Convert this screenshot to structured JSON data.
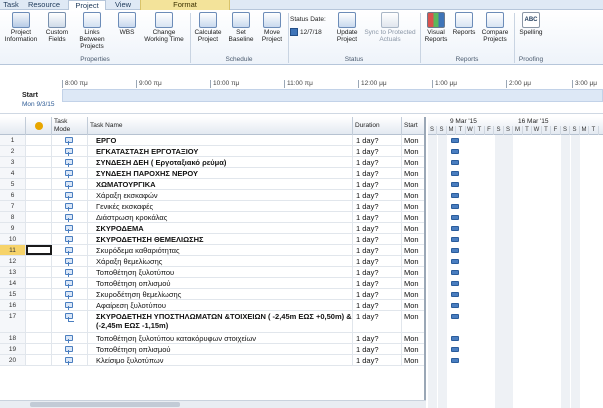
{
  "tabs": [
    "Task",
    "Resource",
    "Project",
    "View",
    "Format"
  ],
  "ribbon": {
    "buttons": {
      "project_information": "Project Information",
      "custom_fields": "Custom Fields",
      "links_between_projects": "Links Between Projects",
      "wbs": "WBS",
      "change_working_time": "Change Working Time",
      "calculate_project": "Calculate Project",
      "set_baseline": "Set Baseline",
      "move_project": "Move Project",
      "update_project": "Update Project",
      "sync_protected": "Sync to Protected Actuals",
      "visual_reports": "Visual Reports",
      "reports": "Reports",
      "compare_projects": "Compare Projects",
      "spelling": "Spelling"
    },
    "status_date_label": "Status Date:",
    "status_date_value": "12/7/18",
    "groups": {
      "properties": "Properties",
      "schedule": "Schedule",
      "status": "Status",
      "reports": "Reports",
      "proofing": "Proofing"
    },
    "spelling_badge": "ABC"
  },
  "timeline": {
    "start_label": "Start",
    "start_date": "Mon 9/3/15",
    "ticks": [
      "8:00 πμ",
      "9:00 πμ",
      "10:00 πμ",
      "11:00 πμ",
      "12:00 μμ",
      "1:00 μμ",
      "2:00 μμ",
      "3:00 μμ"
    ]
  },
  "grid": {
    "headers": {
      "mode": "Task Mode",
      "name": "Task Name",
      "duration": "Duration",
      "start": "Start"
    },
    "rows": [
      {
        "id": "1",
        "name": "ΕΡΓΟ",
        "duration": "1 day?",
        "start": "Mon",
        "bold": true
      },
      {
        "id": "2",
        "name": "ΕΓΚΑΤΑΣΤΑΣΗ ΕΡΓΟΤΑΞΙΟΥ",
        "duration": "1 day?",
        "start": "Mon",
        "bold": true
      },
      {
        "id": "3",
        "name": "ΣΥΝΔΕΣΗ ΔΕΗ ( Εργοταξιακό ρεύμα)",
        "duration": "1 day?",
        "start": "Mon",
        "bold": true
      },
      {
        "id": "4",
        "name": "ΣΥΝΔΕΣΗ ΠΑΡΟΧΗΣ ΝΕΡΟΥ",
        "duration": "1 day?",
        "start": "Mon",
        "bold": true
      },
      {
        "id": "5",
        "name": "ΧΩΜΑΤΟΥΡΓΙΚΑ",
        "duration": "1 day?",
        "start": "Mon",
        "bold": true
      },
      {
        "id": "6",
        "name": "Χάραξη εκσκαφών",
        "duration": "1 day?",
        "start": "Mon",
        "bold": false
      },
      {
        "id": "7",
        "name": "Γενικές εκσκαφές",
        "duration": "1 day?",
        "start": "Mon",
        "bold": false
      },
      {
        "id": "8",
        "name": "Διάστρωση κροκάλας",
        "duration": "1 day?",
        "start": "Mon",
        "bold": false
      },
      {
        "id": "9",
        "name": "ΣΚΥΡΟΔΕΜΑ",
        "duration": "1 day?",
        "start": "Mon",
        "bold": true
      },
      {
        "id": "10",
        "name": "ΣΚΥΡΟΔΕΤΗΣΗ ΘΕΜΕΛΙΩΣΗΣ",
        "duration": "1 day?",
        "start": "Mon",
        "bold": true
      },
      {
        "id": "11",
        "name": "Σκυρόδεμα καθαριότητας",
        "duration": "1 day?",
        "start": "Mon",
        "bold": false
      },
      {
        "id": "12",
        "name": "Χάραξη θεμελίωσης",
        "duration": "1 day?",
        "start": "Mon",
        "bold": false
      },
      {
        "id": "13",
        "name": "Τοποθέτηση ξυλοτύπου",
        "duration": "1 day?",
        "start": "Mon",
        "bold": false
      },
      {
        "id": "14",
        "name": "Τοποθέτηση οπλισμού",
        "duration": "1 day?",
        "start": "Mon",
        "bold": false
      },
      {
        "id": "15",
        "name": "Σκυροδέτηση θεμελίωσης",
        "duration": "1 day?",
        "start": "Mon",
        "bold": false
      },
      {
        "id": "16",
        "name": "Αφαίρεση ξυλοτύπου",
        "duration": "1 day?",
        "start": "Mon",
        "bold": false
      },
      {
        "id": "17",
        "name": "ΣΚΥΡΟΔΕΤΗΣΗ ΥΠΟΣΤΗΛΩΜΑΤΩΝ &ΤΟΙΧΕΙΩΝ ( -2,45m ΕΩΣ +0,50m) & (-2,45m ΕΩΣ -1,15m)",
        "duration": "1 day?",
        "start": "Mon",
        "bold": true
      },
      {
        "id": "18",
        "name": "Τοποθέτηση ξυλοτύπου κατακόρυφων στοιχείων",
        "duration": "1 day?",
        "start": "Mon",
        "bold": false
      },
      {
        "id": "19",
        "name": "Τοποθέτηση οπλισμού",
        "duration": "1 day?",
        "start": "Mon",
        "bold": false
      },
      {
        "id": "20",
        "name": "Κλείσιμο ξυλοτύπων",
        "duration": "1 day?",
        "start": "Mon",
        "bold": false
      }
    ]
  },
  "gantt": {
    "weeks": [
      "9 Mar '15",
      "16 Mar '15"
    ],
    "days": [
      "S",
      "S",
      "M",
      "T",
      "W",
      "T",
      "F",
      "S",
      "S",
      "M",
      "T",
      "W",
      "T",
      "F",
      "S",
      "S",
      "M",
      "T"
    ]
  },
  "colors": {
    "accent": "#4a7ec0",
    "format_tab": "#f3e39a",
    "selected_row": "#f6d36a"
  }
}
